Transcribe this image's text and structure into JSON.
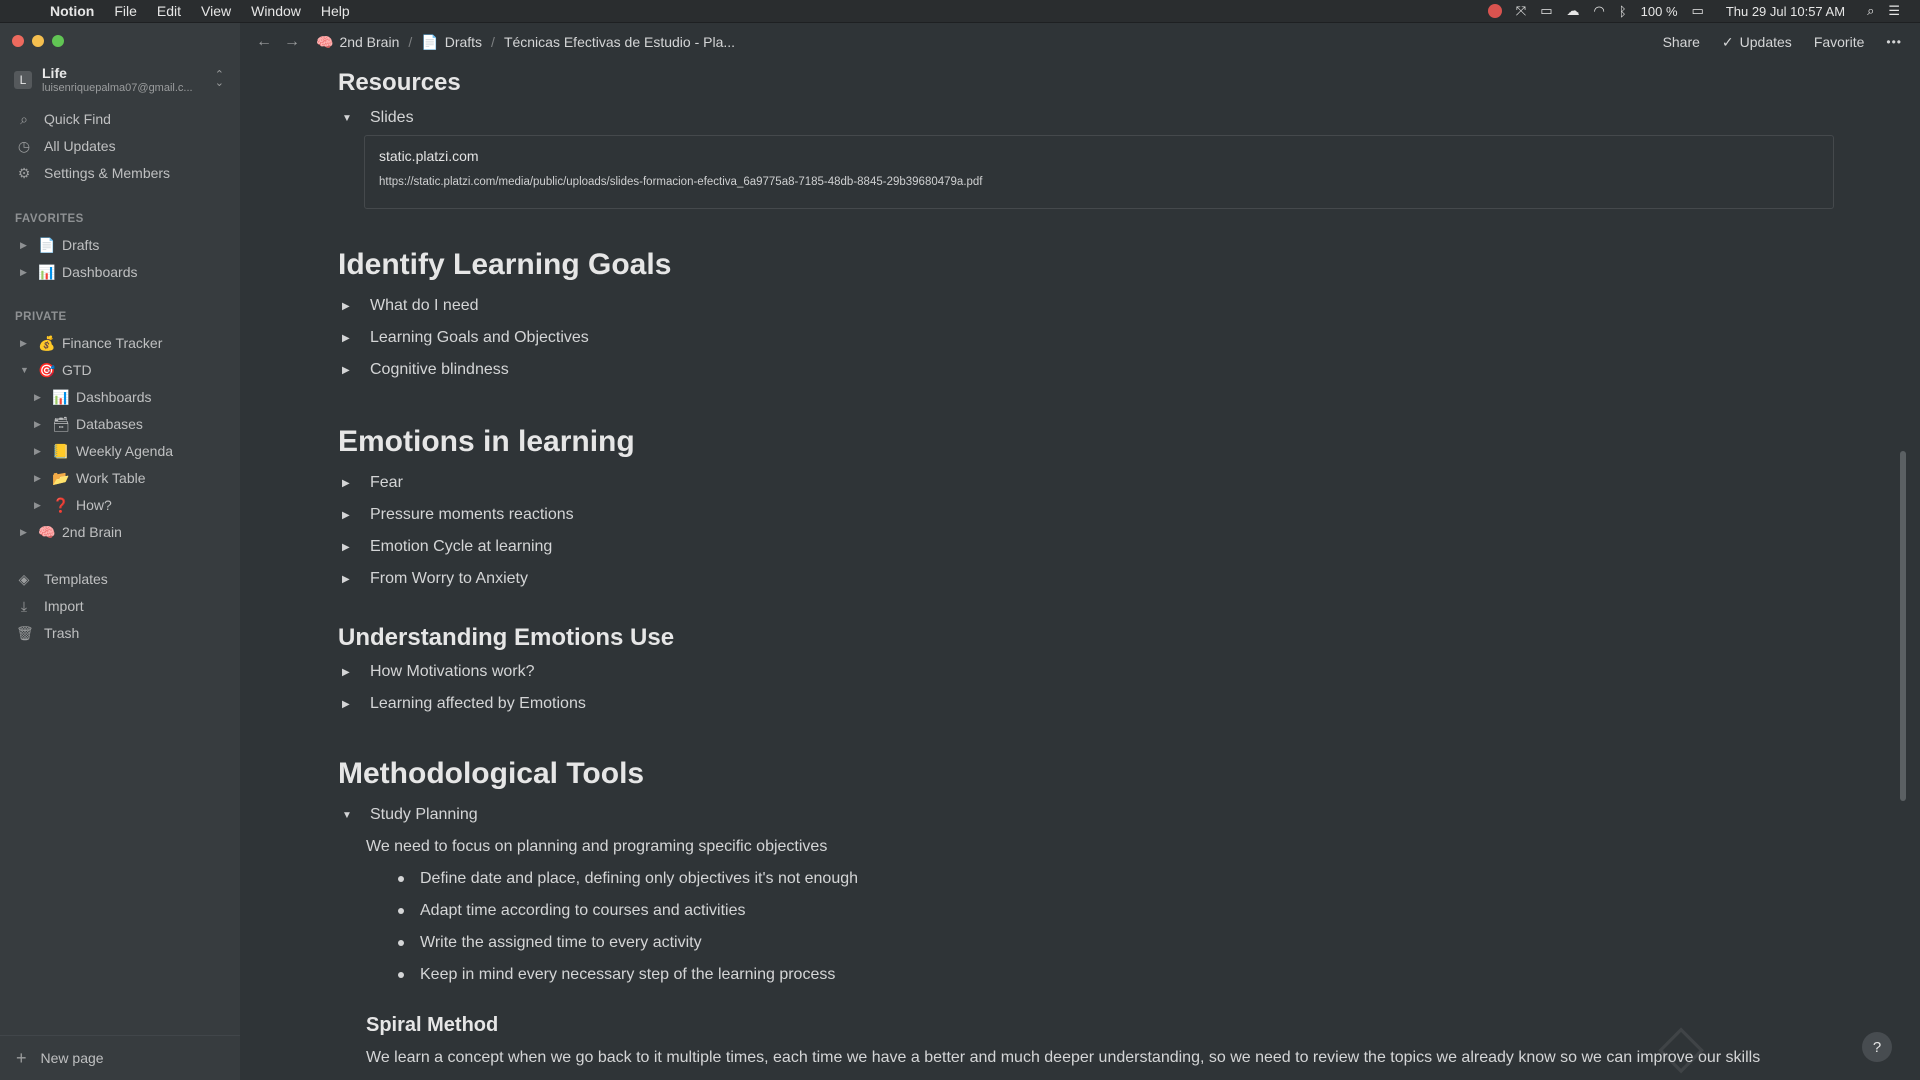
{
  "menubar": {
    "app": "Notion",
    "items": [
      "File",
      "Edit",
      "View",
      "Window",
      "Help"
    ],
    "battery": "100 %",
    "datetime": "Thu 29 Jul  10:57 AM"
  },
  "workspace": {
    "name": "Life",
    "email": "luisenriquepalma07@gmail.c...",
    "badge": "L"
  },
  "sidebar": {
    "quick_find": "Quick Find",
    "all_updates": "All Updates",
    "settings": "Settings & Members",
    "favorites_label": "FAVORITES",
    "favorites": [
      {
        "icon": "📄",
        "label": "Drafts"
      },
      {
        "icon": "📊",
        "label": "Dashboards"
      }
    ],
    "private_label": "PRIVATE",
    "private": [
      {
        "icon": "💰",
        "label": "Finance Tracker"
      },
      {
        "icon": "🎯",
        "label": "GTD"
      },
      {
        "icon": "📊",
        "label": "Dashboards"
      },
      {
        "icon": "🗃",
        "label": "Databases"
      },
      {
        "icon": "📒",
        "label": "Weekly Agenda"
      },
      {
        "icon": "📂",
        "label": "Work Table"
      },
      {
        "icon": "❓",
        "label": "How?"
      },
      {
        "icon": "🧠",
        "label": "2nd Brain"
      }
    ],
    "templates": "Templates",
    "import": "Import",
    "trash": "Trash",
    "new_page": "New page"
  },
  "topbar": {
    "crumbs": [
      {
        "icon": "🧠",
        "label": "2nd Brain"
      },
      {
        "icon": "📄",
        "label": "Drafts"
      },
      {
        "icon": "",
        "label": "Técnicas Efectivas de Estudio - Pla..."
      }
    ],
    "share": "Share",
    "updates": "Updates",
    "favorite": "Favorite",
    "more": "•••"
  },
  "content": {
    "resources": "Resources",
    "slides": "Slides",
    "bookmark_title": "static.platzi.com",
    "bookmark_url": "https://static.platzi.com/media/public/uploads/slides-formacion-efectiva_6a9775a8-7185-48db-8845-29b39680479a.pdf",
    "goals_heading": "Identify Learning Goals",
    "goals_items": [
      "What do I need",
      "Learning Goals and Objectives",
      "Cognitive blindness"
    ],
    "emotions_heading": "Emotions in learning",
    "emotions_items": [
      "Fear",
      "Pressure moments reactions",
      "Emotion Cycle at learning",
      "From Worry to Anxiety"
    ],
    "understanding_heading": "Understanding Emotions Use",
    "understanding_items": [
      "How Motivations work?",
      "Learning affected by Emotions"
    ],
    "tools_heading": "Methodological Tools",
    "study_planning": "Study Planning",
    "planning_para": "We need to focus on planning and programing specific objectives",
    "planning_bullets": [
      "Define date and place, defining only objectives it's not enough",
      "Adapt time according to courses and activities",
      "Write the assigned time to every activity",
      "Keep in mind every necessary step of the learning process"
    ],
    "spiral_heading": "Spiral Method",
    "spiral_para": "We learn a concept when we go back to it multiple times, each time we have a better and much deeper understanding, so we need to review the topics we already know so we can improve our skills"
  },
  "help": "?"
}
